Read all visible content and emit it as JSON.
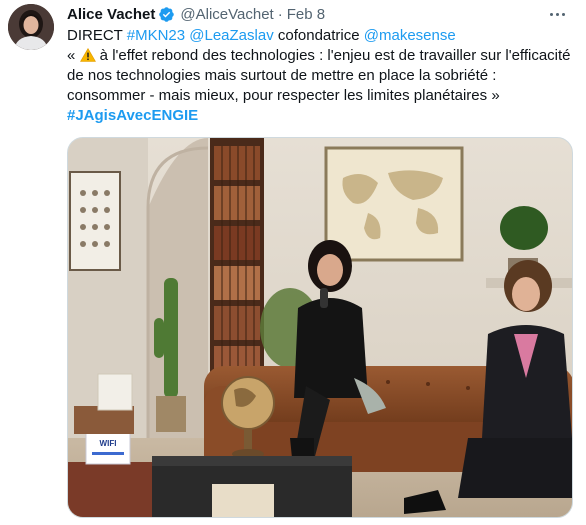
{
  "tweet": {
    "author_name": "Alice Vachet",
    "handle": "@AliceVachet",
    "separator": "·",
    "date": "Feb 8",
    "line1": {
      "prefix": "DIRECT ",
      "hashtag": "#MKN23",
      "mention1": "@LeaZaslav",
      "middle": " cofondatrice ",
      "mention2": "@makesense"
    },
    "quote_open": "« ",
    "quote_body": " à l'effet rebond des technologies : l'enjeu est de travailler sur l'efficacité de nos technologies mais surtout de mettre en place la sobriété : consommer - mais mieux, pour respecter les limites planétaires » ",
    "hashtag_final": "#JAgisAvecENGIE",
    "media": {
      "wifi_sign": "WIFI"
    }
  },
  "colors": {
    "accent": "#1d9bf0",
    "text": "#0f1419",
    "secondary": "#536471"
  },
  "icons": [
    "verified-badge-icon",
    "warning-icon",
    "more-options-icon"
  ]
}
